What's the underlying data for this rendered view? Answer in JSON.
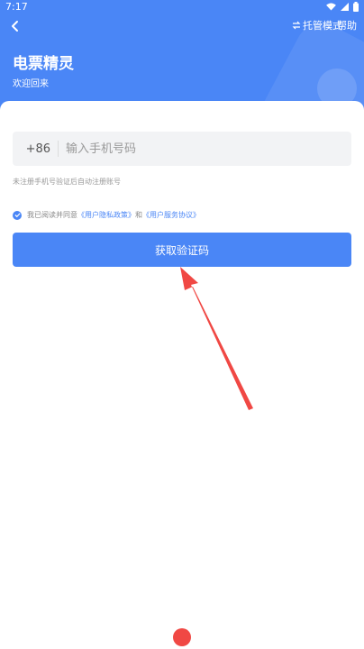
{
  "status": {
    "time": "7:17"
  },
  "header": {
    "mode_label": "托管模式",
    "help_label": "帮助",
    "app_title": "电票精灵",
    "welcome": "欢迎回来"
  },
  "form": {
    "country_code": "+86",
    "phone_placeholder": "输入手机号码",
    "hint": "未注册手机号验证后自动注册账号",
    "agreement_prefix": "我已阅读并同意",
    "privacy_link": "《用户隐私政策》",
    "agreement_and": "和",
    "terms_link": "《用户服务协议》",
    "submit_label": "获取验证码"
  },
  "colors": {
    "accent": "#4a86f6",
    "annotation_arrow": "#f04844"
  }
}
